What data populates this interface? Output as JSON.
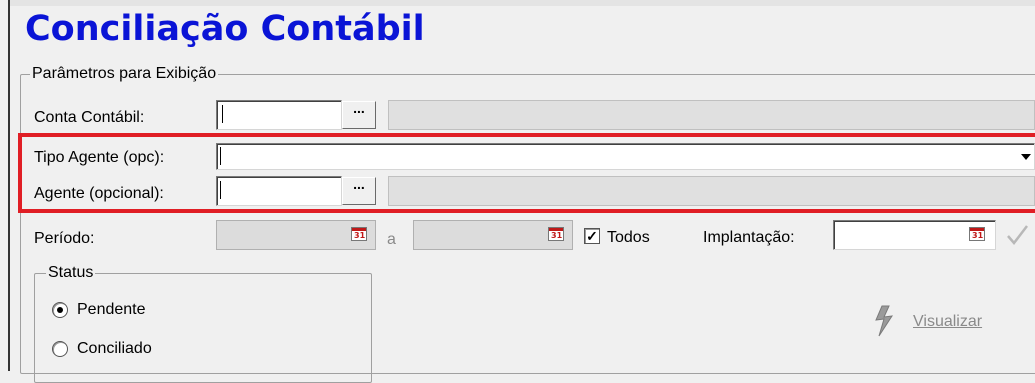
{
  "window": {
    "title": "Conciliação Contábil"
  },
  "params": {
    "legend": "Parâmetros para Exibição",
    "conta_label": "Conta Contábil:",
    "tipo_agente_label": "Tipo Agente (opc):",
    "agente_label": "Agente (opcional):",
    "periodo_label": "Período:",
    "periodo_sep": "a",
    "todos_label": "Todos",
    "todos_checked": true,
    "implantacao_label": "Implantação:",
    "ellipsis": "..."
  },
  "status": {
    "legend": "Status",
    "options": [
      "Pendente",
      "Conciliado"
    ],
    "selected": "Pendente"
  },
  "actions": {
    "visualizar_label": "Visualizar"
  },
  "icons": {
    "calendar": "calendar-icon",
    "lightning": "lightning-icon",
    "check": "check-icon",
    "dropdown": "chevron-down-icon"
  },
  "colors": {
    "title": "#0a14d6",
    "highlight": "#e01e25"
  }
}
